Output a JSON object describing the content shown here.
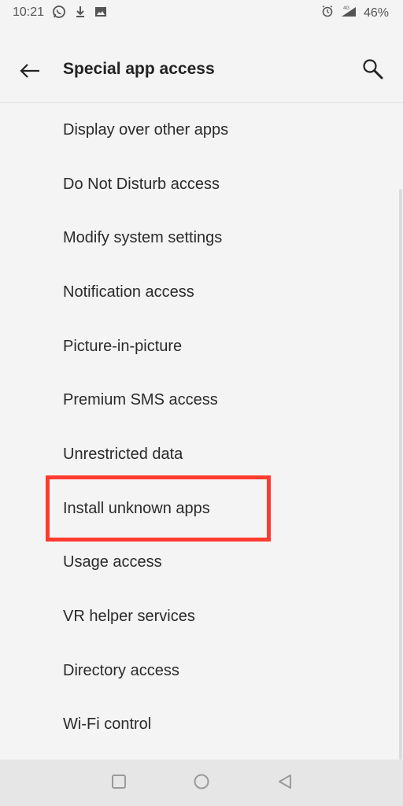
{
  "status_bar": {
    "time": "10:21",
    "battery": "46%",
    "icons": [
      "whatsapp-icon",
      "download-icon",
      "image-icon",
      "alarm-icon",
      "signal-4g-icon"
    ]
  },
  "app_bar": {
    "title": "Special app access",
    "back_icon": "back-arrow-icon",
    "search_icon": "search-icon"
  },
  "items": [
    {
      "label": "Display over other apps"
    },
    {
      "label": "Do Not Disturb access"
    },
    {
      "label": "Modify system settings"
    },
    {
      "label": "Notification access"
    },
    {
      "label": "Picture-in-picture"
    },
    {
      "label": "Premium SMS access"
    },
    {
      "label": "Unrestricted data"
    },
    {
      "label": "Install unknown apps"
    },
    {
      "label": "Usage access"
    },
    {
      "label": "VR helper services"
    },
    {
      "label": "Directory access"
    },
    {
      "label": "Wi-Fi control"
    }
  ],
  "highlighted_item": "Install unknown apps",
  "colors": {
    "background": "#f4f4f4",
    "highlight": "#ff3b2f",
    "nav_bar": "#e6e6e6"
  },
  "nav_bar": {
    "icons": [
      "recent-apps-icon",
      "home-icon",
      "back-icon"
    ]
  }
}
